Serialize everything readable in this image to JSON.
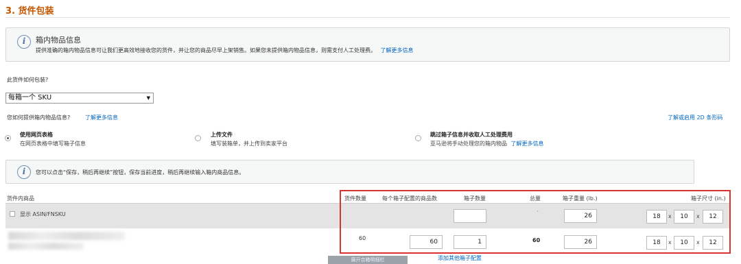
{
  "section": {
    "title": "3. 货件包装"
  },
  "info_box": {
    "title": "箱内物品信息",
    "text": "提供准确的箱内物品信息可让我们更高效地接收您的货件，并让您的商品尽早上架销售。如果您未提供箱内物品信息，则需支付人工处理费。",
    "link": "了解更多信息"
  },
  "packing": {
    "question": "此货件如何包装?",
    "selected": "每箱一个 SKU",
    "caret": "▼"
  },
  "provide": {
    "question": "您如何提供箱内物品信息?",
    "learn_more": "了解更多信息",
    "barcode_link": "了解或启用 2D 条形码"
  },
  "options": [
    {
      "title": "使用网页表格",
      "desc": "在网页表格中填写箱子信息",
      "checked": true
    },
    {
      "title": "上传文件",
      "desc": "填写装箱单，并上传到卖家平台",
      "checked": false
    },
    {
      "title": "跳过箱子信息并收取人工处理费用",
      "desc": "亚马逊将手动处理您的箱内物品",
      "link": "了解更多信息",
      "checked": false
    }
  ],
  "notice": {
    "text": "您可以点击“保存，稍后再继续”按钮，保存当前进度，稍后再继续输入箱内商品信息。"
  },
  "table": {
    "headers": {
      "product": "货件内商品",
      "shipment_qty": "货件数量",
      "units_per_box": "每个箱子配置的商品数",
      "box_count": "箱子数量",
      "total": "总量",
      "box_weight": "箱子重量 (lb.)",
      "box_dims": "箱子尺寸 (in.)"
    },
    "show_asin_label": "显示 ASIN/FNSKU",
    "row1": {
      "total": "`",
      "weight": "26",
      "dims": [
        "18",
        "10",
        "12"
      ]
    },
    "row2": {
      "shipment_qty": "60",
      "units_per_box": "60",
      "box_count": "1",
      "total": "60",
      "weight": "26",
      "dims": [
        "18",
        "10",
        "12"
      ]
    },
    "times": "x"
  },
  "footer": {
    "open_button": "展开合箱明细栏",
    "add_config_link": "添加其他箱子配置"
  }
}
